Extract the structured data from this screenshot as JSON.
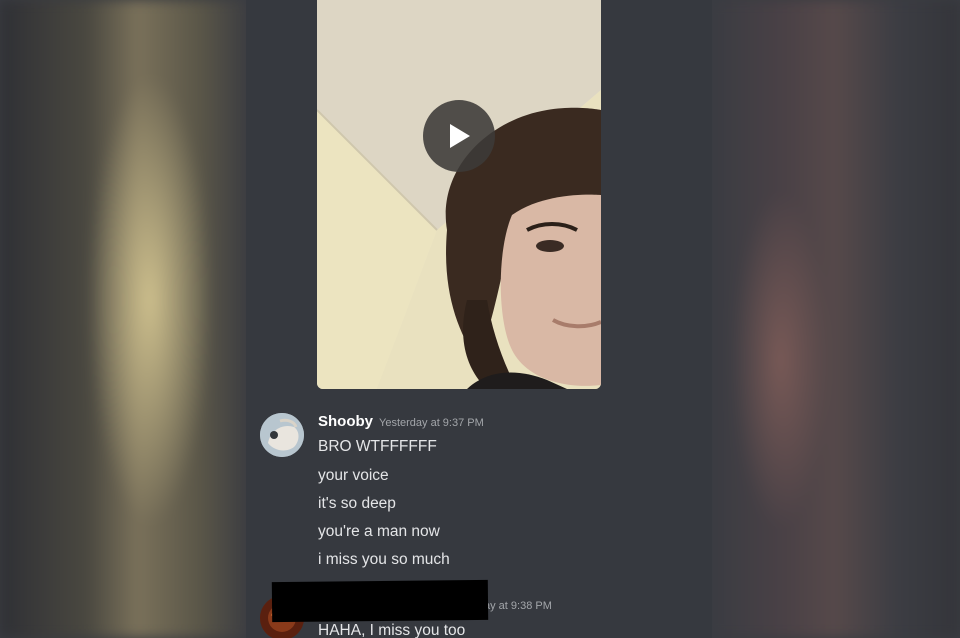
{
  "message1": {
    "username": "Shooby",
    "timestamp": "Yesterday at 9:37 PM",
    "lines": [
      "BRO WTFFFFFF",
      "your voice",
      "it's so deep",
      "you're a man now",
      "i miss you so much"
    ]
  },
  "message2": {
    "timestamp": "ay at 9:38 PM",
    "lines": [
      "HAHA, I miss you too"
    ]
  },
  "icons": {
    "play": "play-icon"
  },
  "colors": {
    "background": "#36393f",
    "username": "#ffffff",
    "timestamp": "#a3a6aa",
    "text": "#e4e5e7"
  }
}
